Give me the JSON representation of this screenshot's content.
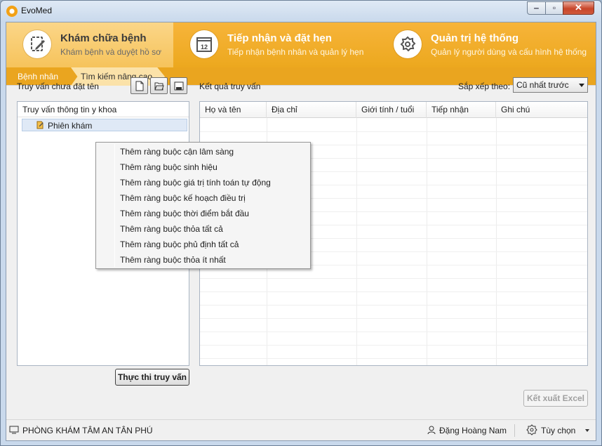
{
  "window": {
    "title": "EvoMed"
  },
  "ribbon": {
    "tabs": [
      {
        "title": "Khám chữa bệnh",
        "subtitle": "Khám bệnh và duyệt hồ sơ",
        "icon": "edit-doc-icon"
      },
      {
        "title": "Tiếp nhận và đặt hẹn",
        "subtitle": "Tiếp nhận bệnh nhân và quản lý hẹn",
        "icon": "calendar-icon",
        "date": "12"
      },
      {
        "title": "Quản trị hệ thống",
        "subtitle": "Quản lý người dùng và cấu hình hệ thống",
        "icon": "gear-icon"
      }
    ],
    "active_tab": 0
  },
  "breadcrumb": {
    "items": [
      "Bệnh nhân",
      "Tìm kiếm nâng cao"
    ]
  },
  "left": {
    "title": "Truy vấn chưa đặt tên",
    "tree_header": "Truy vấn thông tin y khoa",
    "tree_node": "Phiên khám",
    "run_label": "Thực thi truy vấn"
  },
  "right": {
    "title": "Kết quả truy vấn",
    "sort_label": "Sắp xếp theo:",
    "sort_value": "Cũ nhất trước",
    "columns": [
      "Họ và tên",
      "Địa chỉ",
      "Giới tính / tuổi",
      "Tiếp nhận",
      "Ghi chú"
    ],
    "export_label": "Kết xuất Excel"
  },
  "context_menu": {
    "items": [
      "Thêm ràng buộc cận lâm sàng",
      "Thêm ràng buộc sinh hiệu",
      "Thêm ràng buộc giá trị tính toán tự động",
      "Thêm ràng buộc kế hoạch điều trị",
      "Thêm ràng buộc thời điểm bắt đầu",
      "Thêm ràng buộc thỏa tất cả",
      "Thêm ràng buộc phủ định tất cả",
      "Thêm ràng buộc thỏa ít nhất"
    ]
  },
  "status": {
    "clinic": "PHÒNG KHÁM TÂM AN TÂN PHÚ",
    "user": "Đặng Hoàng Nam",
    "options": "Tùy chọn"
  }
}
